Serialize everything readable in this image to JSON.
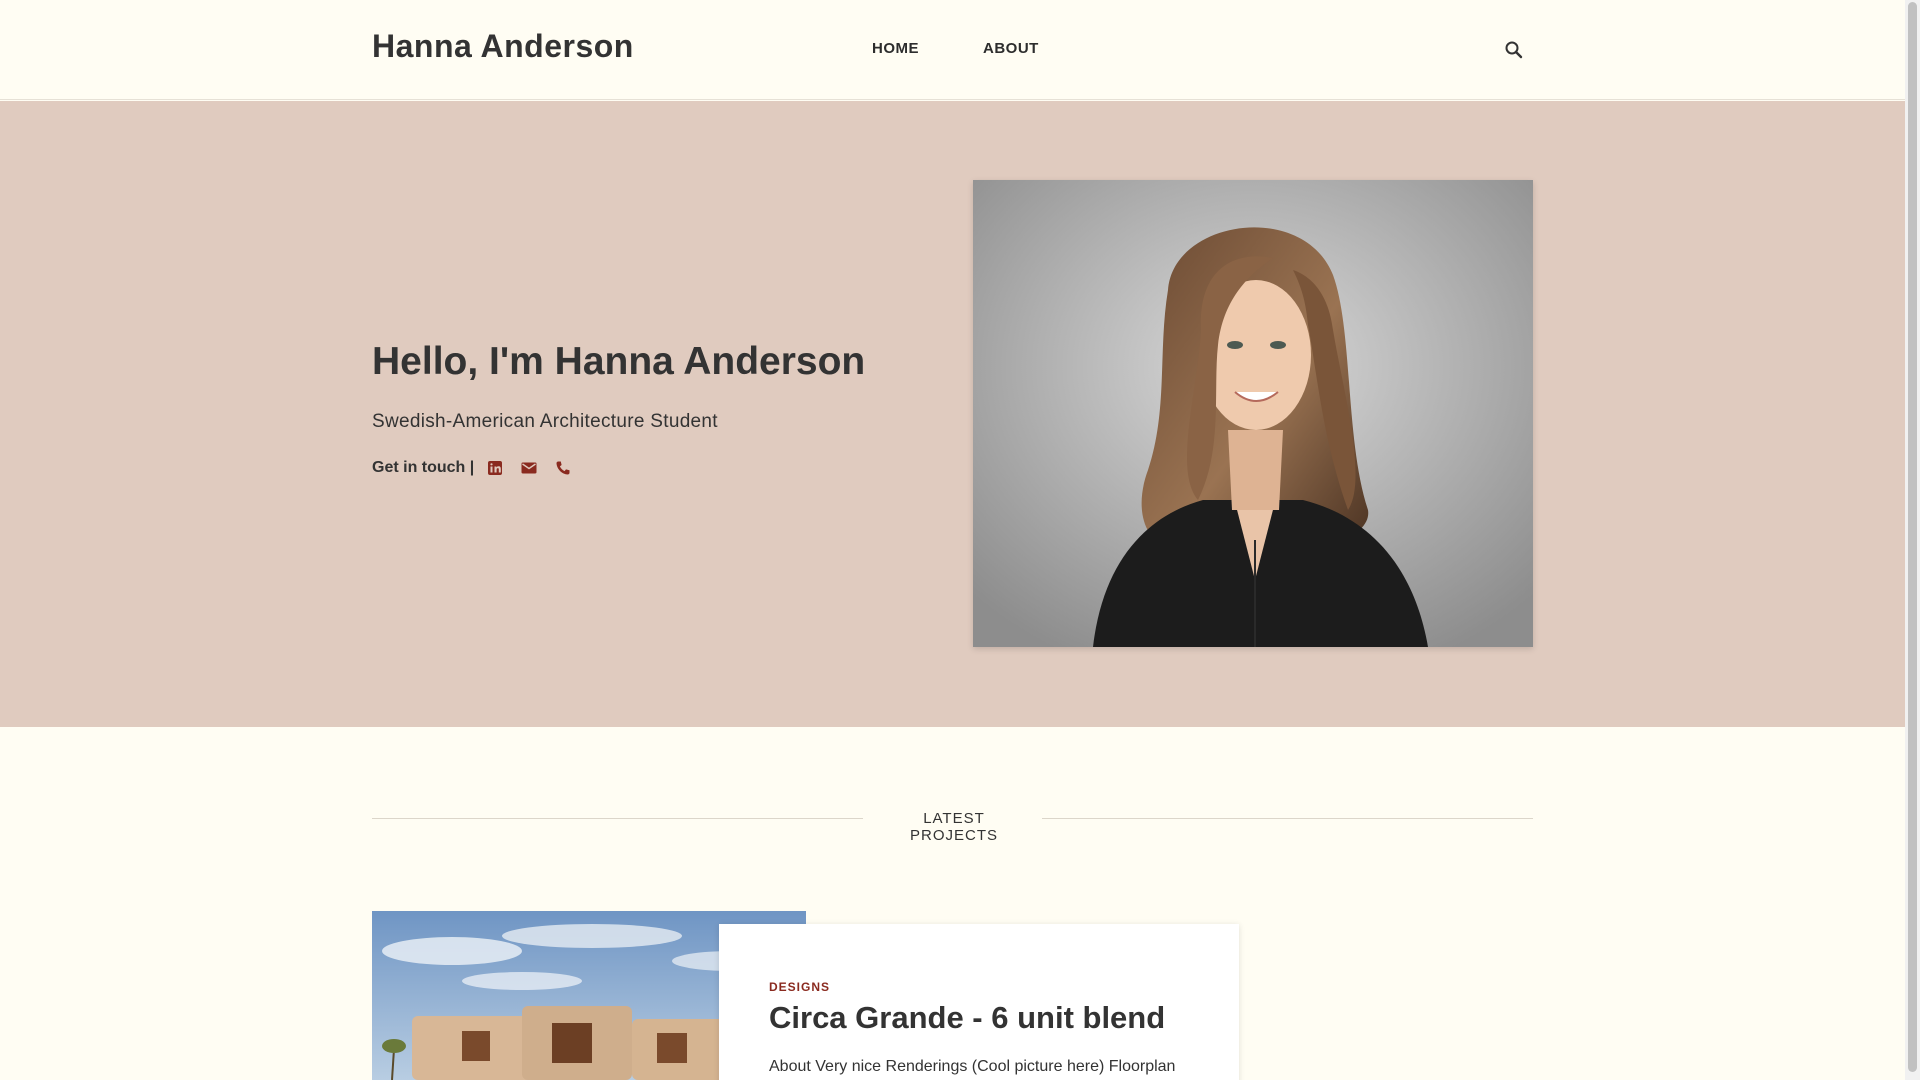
{
  "header": {
    "brand": "Hanna Anderson",
    "nav": [
      "HOME",
      "ABOUT"
    ],
    "search_icon": "search-icon"
  },
  "hero": {
    "greeting": "Hello, I'm ",
    "name": "Hanna Anderson",
    "subtitle": "Swedish-American Architecture Student",
    "contact_label": "Get in touch |",
    "contact_icons": [
      "linkedin-icon",
      "email-icon",
      "phone-icon"
    ],
    "accent_color": "#8a2a1f",
    "background_color": "#e0cbbf"
  },
  "latest": {
    "heading": "LATEST PROJECTS"
  },
  "project": {
    "category": "DESIGNS",
    "title": "Circa Grande - 6 unit blend",
    "excerpt": "About Very nice Renderings (Cool picture here) Floorplan"
  }
}
